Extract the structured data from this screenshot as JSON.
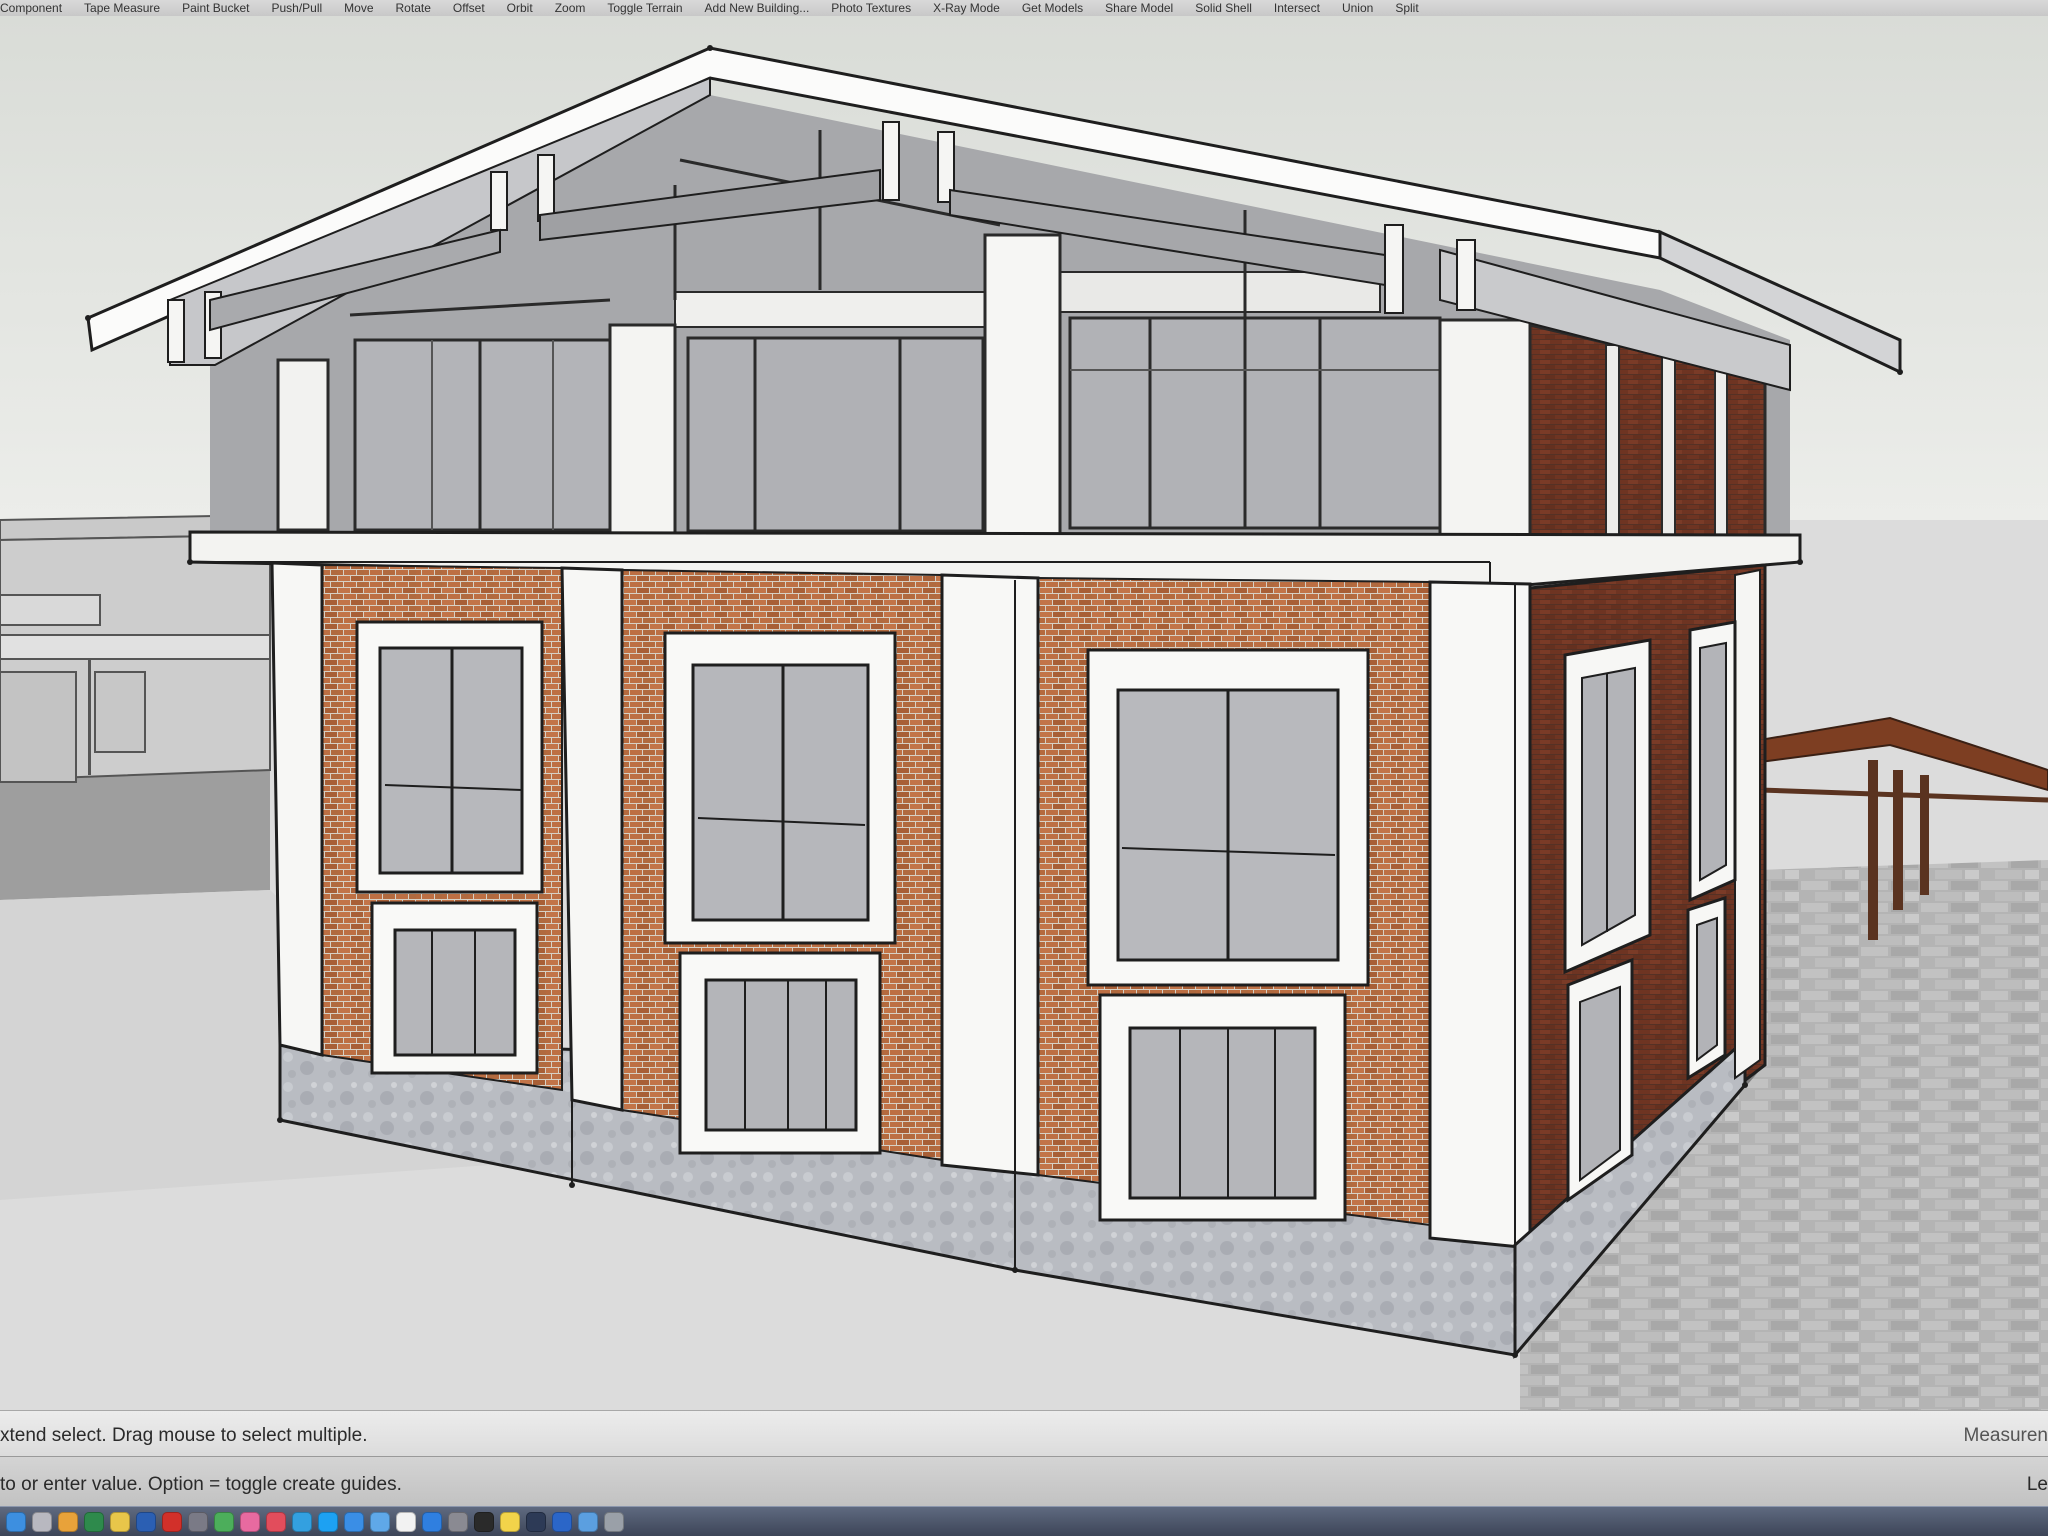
{
  "toolbar": {
    "tools": [
      "Component",
      "Tape Measure",
      "Paint Bucket",
      "Push/Pull",
      "Move",
      "Rotate",
      "Offset",
      "Orbit",
      "Zoom",
      "Toggle Terrain",
      "Add New Building...",
      "Photo Textures",
      "X-Ray Mode",
      "Get Models",
      "Share Model",
      "Solid Shell",
      "Intersect",
      "Union",
      "Split"
    ]
  },
  "status_bar": {
    "primary_hint": "xtend select. Drag mouse to select multiple.",
    "measurements_label": "Measuren",
    "secondary_hint": "to or enter value.  Option = toggle create guides.",
    "secondary_right": "Le"
  },
  "colors": {
    "sky": "#e4e6e2",
    "ground": "#dedede",
    "brick": "#b56a3e",
    "trim": "#f7f7f5",
    "plinth": "#b9bcc2",
    "glass": "#b8b9bd",
    "dark_brick": "#6e3422"
  },
  "dock": {
    "icons": [
      "finder-icon",
      "launchpad-icon",
      "sketch-icon",
      "excel-icon",
      "chrome-icon",
      "word-icon",
      "acrobat-icon",
      "help-icon",
      "maps-icon",
      "photos-icon",
      "music-icon",
      "skype-icon",
      "twitter-icon",
      "safari-icon",
      "mail-icon",
      "calendar-icon",
      "app-store-icon",
      "preferences-icon",
      "terminal-icon",
      "notes-icon",
      "lightroom-icon",
      "photoshop-icon",
      "folder-icon",
      "trash-icon"
    ]
  }
}
